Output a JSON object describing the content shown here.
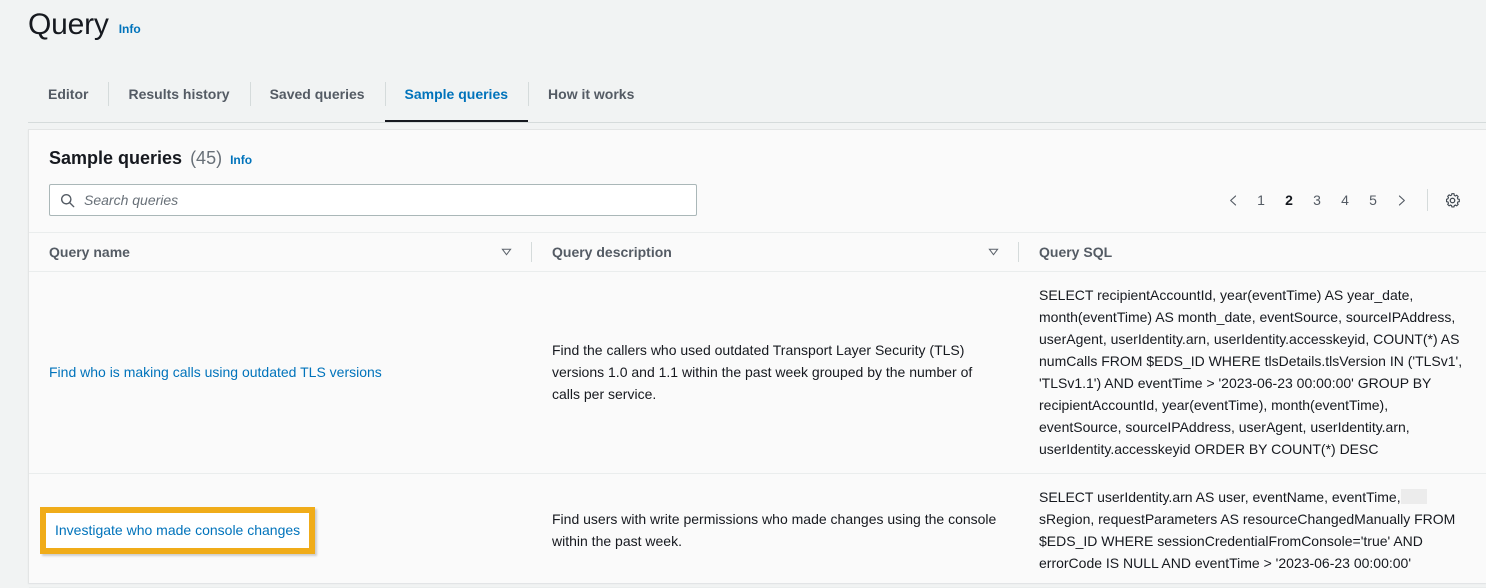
{
  "header": {
    "title": "Query",
    "info_label": "Info"
  },
  "tabs": [
    {
      "label": "Editor",
      "active": false
    },
    {
      "label": "Results history",
      "active": false
    },
    {
      "label": "Saved queries",
      "active": false
    },
    {
      "label": "Sample queries",
      "active": true
    },
    {
      "label": "How it works",
      "active": false
    }
  ],
  "panel": {
    "title": "Sample queries",
    "count": "(45)",
    "info_label": "Info"
  },
  "search": {
    "placeholder": "Search queries",
    "value": "",
    "icon": "search-icon"
  },
  "pagination": {
    "prev_icon": "chevron-left-icon",
    "next_icon": "chevron-right-icon",
    "pages": [
      "1",
      "2",
      "3",
      "4",
      "5"
    ],
    "current": "2",
    "settings_icon": "gear-icon"
  },
  "table": {
    "columns": [
      {
        "label": "Query name",
        "sort_icon": "sort-triangle-icon"
      },
      {
        "label": "Query description",
        "sort_icon": "sort-triangle-icon"
      },
      {
        "label": "Query SQL",
        "sort_icon": ""
      }
    ],
    "rows": [
      {
        "name": "Find who is making calls using outdated TLS versions",
        "description": "Find the callers who used outdated Transport Layer Security (TLS) versions 1.0 and 1.1 within the past week grouped by the number of calls per service.",
        "sql_before": "SELECT recipientAccountId, year(eventTime) AS year_date, month(eventTime) AS month_date, eventSource, sourceIPAddress, userAgent, userIdentity.arn, userIdentity.accesskeyid, COUNT(*) AS numCalls FROM $EDS_ID WHERE tlsDetails.tlsVersion IN ('TLSv1', 'TLSv1.1') AND eventTime > '2023-06-23 00:00:00' GROUP BY recipientAccountId, year(eventTime), month(eventTime), eventSource, sourceIPAddress, userAgent, userIdentity.arn, userIdentity.accesskeyid ORDER BY COUNT(*) DESC",
        "sql_after": "",
        "redacted": false,
        "highlighted": false
      },
      {
        "name": "Investigate who made console changes",
        "description": "Find users with write permissions who made changes using the console within the past week.",
        "sql_before": "SELECT userIdentity.arn AS user, eventName, eventTime,",
        "sql_after": "sRegion, requestParameters AS resourceChangedManually FROM $EDS_ID WHERE sessionCredentialFromConsole='true' AND errorCode IS NULL AND eventTime > '2023-06-23 00:00:00'",
        "redacted": true,
        "highlighted": true
      }
    ]
  },
  "colors": {
    "accent_link": "#0073bb",
    "highlight_box": "#f0ac19",
    "page_bg": "#f1f3f3",
    "card_bg": "#fafafa",
    "text": "#16191f",
    "muted_text": "#545b64"
  }
}
